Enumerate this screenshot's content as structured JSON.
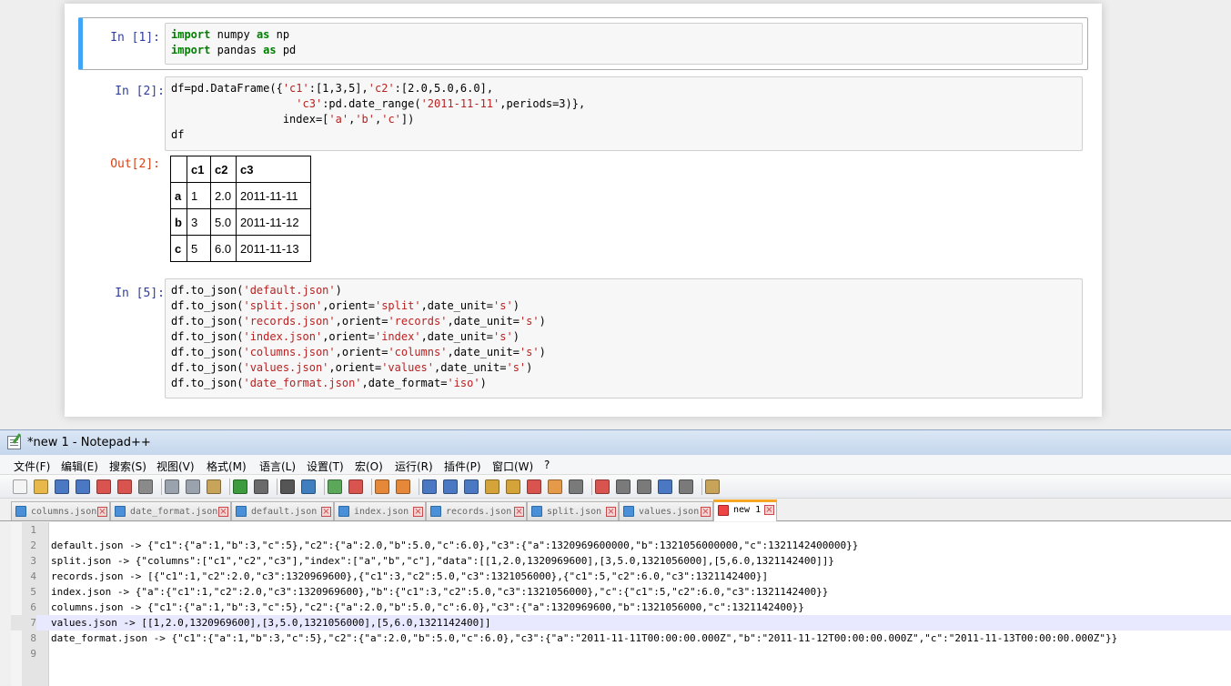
{
  "notebook": {
    "cells": [
      {
        "prompt": "In  [1]:",
        "lines": [
          [
            {
              "t": "import",
              "c": "kw"
            },
            {
              "t": " numpy "
            },
            {
              "t": "as",
              "c": "kw"
            },
            {
              "t": " np"
            }
          ],
          [
            {
              "t": "import",
              "c": "kw"
            },
            {
              "t": " pandas "
            },
            {
              "t": "as",
              "c": "kw"
            },
            {
              "t": " pd"
            }
          ]
        ]
      },
      {
        "prompt": "In  [2]:",
        "lines": [
          [
            {
              "t": "df=pd.DataFrame({"
            },
            {
              "t": "'c1'",
              "c": "st"
            },
            {
              "t": ":[1,3,5],"
            },
            {
              "t": "'c2'",
              "c": "st"
            },
            {
              "t": ":[2.0,5.0,6.0],"
            }
          ],
          [
            {
              "t": "                   "
            },
            {
              "t": "'c3'",
              "c": "st"
            },
            {
              "t": ":pd.date_range("
            },
            {
              "t": "'2011-11-11'",
              "c": "st"
            },
            {
              "t": ",periods=3)},"
            }
          ],
          [
            {
              "t": "                 index=["
            },
            {
              "t": "'a'",
              "c": "st"
            },
            {
              "t": ","
            },
            {
              "t": "'b'",
              "c": "st"
            },
            {
              "t": ","
            },
            {
              "t": "'c'",
              "c": "st"
            },
            {
              "t": "])"
            }
          ],
          [
            {
              "t": "df"
            }
          ]
        ]
      },
      {
        "prompt": "In  [5]:",
        "lines": [
          [
            {
              "t": "df.to_json("
            },
            {
              "t": "'default.json'",
              "c": "st"
            },
            {
              "t": ")"
            }
          ],
          [
            {
              "t": "df.to_json("
            },
            {
              "t": "'split.json'",
              "c": "st"
            },
            {
              "t": ",orient="
            },
            {
              "t": "'split'",
              "c": "st"
            },
            {
              "t": ",date_unit="
            },
            {
              "t": "'s'",
              "c": "st"
            },
            {
              "t": ")"
            }
          ],
          [
            {
              "t": "df.to_json("
            },
            {
              "t": "'records.json'",
              "c": "st"
            },
            {
              "t": ",orient="
            },
            {
              "t": "'records'",
              "c": "st"
            },
            {
              "t": ",date_unit="
            },
            {
              "t": "'s'",
              "c": "st"
            },
            {
              "t": ")"
            }
          ],
          [
            {
              "t": "df.to_json("
            },
            {
              "t": "'index.json'",
              "c": "st"
            },
            {
              "t": ",orient="
            },
            {
              "t": "'index'",
              "c": "st"
            },
            {
              "t": ",date_unit="
            },
            {
              "t": "'s'",
              "c": "st"
            },
            {
              "t": ")"
            }
          ],
          [
            {
              "t": "df.to_json("
            },
            {
              "t": "'columns.json'",
              "c": "st"
            },
            {
              "t": ",orient="
            },
            {
              "t": "'columns'",
              "c": "st"
            },
            {
              "t": ",date_unit="
            },
            {
              "t": "'s'",
              "c": "st"
            },
            {
              "t": ")"
            }
          ],
          [
            {
              "t": "df.to_json("
            },
            {
              "t": "'values.json'",
              "c": "st"
            },
            {
              "t": ",orient="
            },
            {
              "t": "'values'",
              "c": "st"
            },
            {
              "t": ",date_unit="
            },
            {
              "t": "'s'",
              "c": "st"
            },
            {
              "t": ")"
            }
          ],
          [
            {
              "t": "df.to_json("
            },
            {
              "t": "'date_format.json'",
              "c": "st"
            },
            {
              "t": ",date_format="
            },
            {
              "t": "'iso'",
              "c": "st"
            },
            {
              "t": ")"
            }
          ]
        ]
      }
    ],
    "output": {
      "prompt": "Out[2]:",
      "columns": [
        "",
        "c1",
        "c2",
        "c3"
      ],
      "rows": [
        [
          "a",
          "1",
          "2.0",
          "2011-11-11"
        ],
        [
          "b",
          "3",
          "5.0",
          "2011-11-12"
        ],
        [
          "c",
          "5",
          "6.0",
          "2011-11-13"
        ]
      ]
    }
  },
  "npp": {
    "title": "*new 1 - Notepad++",
    "menu": [
      "文件(F)",
      "编辑(E)",
      "搜索(S)",
      "视图(V)",
      "格式(M)",
      "语言(L)",
      "设置(T)",
      "宏(O)",
      "运行(R)",
      "插件(P)",
      "窗口(W)",
      "?"
    ],
    "toolbar_icons": [
      {
        "name": "new-file-icon",
        "color": "#f4f4f4"
      },
      {
        "name": "open-file-icon",
        "color": "#e8b84a"
      },
      {
        "name": "save-icon",
        "color": "#4a78c2"
      },
      {
        "name": "save-all-icon",
        "color": "#4a78c2"
      },
      {
        "name": "close-icon",
        "color": "#d9534f"
      },
      {
        "name": "close-all-icon",
        "color": "#d9534f"
      },
      {
        "name": "print-icon",
        "color": "#8a8a8a"
      },
      {
        "name": "sep"
      },
      {
        "name": "cut-icon",
        "color": "#9aa3ad"
      },
      {
        "name": "copy-icon",
        "color": "#9aa3ad"
      },
      {
        "name": "paste-icon",
        "color": "#c8a45a"
      },
      {
        "name": "sep"
      },
      {
        "name": "undo-icon",
        "color": "#3c9b3c"
      },
      {
        "name": "redo-icon",
        "color": "#6a6a6a"
      },
      {
        "name": "sep"
      },
      {
        "name": "find-icon",
        "color": "#555555"
      },
      {
        "name": "replace-icon",
        "color": "#3f7fbf"
      },
      {
        "name": "sep"
      },
      {
        "name": "zoom-in-icon",
        "color": "#5ba85b"
      },
      {
        "name": "zoom-out-icon",
        "color": "#d9534f"
      },
      {
        "name": "sep"
      },
      {
        "name": "sync-vertical-icon",
        "color": "#e6883a"
      },
      {
        "name": "sync-horizontal-icon",
        "color": "#e6883a"
      },
      {
        "name": "sep"
      },
      {
        "name": "word-wrap-icon",
        "color": "#4a78c2"
      },
      {
        "name": "show-all-chars-icon",
        "color": "#4a78c2"
      },
      {
        "name": "indent-guide-icon",
        "color": "#4a78c2"
      },
      {
        "name": "udl-icon",
        "color": "#d4a43a"
      },
      {
        "name": "doc-map-icon",
        "color": "#d4a43a"
      },
      {
        "name": "function-list-icon",
        "color": "#d9534f"
      },
      {
        "name": "folder-workspace-icon",
        "color": "#e59a4a"
      },
      {
        "name": "monitoring-icon",
        "color": "#7a7a7a"
      },
      {
        "name": "sep"
      },
      {
        "name": "record-macro-icon",
        "color": "#d9534f"
      },
      {
        "name": "stop-record-icon",
        "color": "#7a7a7a"
      },
      {
        "name": "play-macro-icon",
        "color": "#7a7a7a"
      },
      {
        "name": "run-macro-multiple-icon",
        "color": "#4a78c2"
      },
      {
        "name": "save-macro-icon",
        "color": "#7a7a7a"
      },
      {
        "name": "sep"
      },
      {
        "name": "spell-check-icon",
        "color": "#c8a45a"
      }
    ],
    "tabs": [
      {
        "label": "columns.json",
        "active": false
      },
      {
        "label": "date_format.json",
        "active": false
      },
      {
        "label": "default.json",
        "active": false
      },
      {
        "label": "index.json",
        "active": false
      },
      {
        "label": "records.json",
        "active": false
      },
      {
        "label": "split.json",
        "active": false
      },
      {
        "label": "values.json",
        "active": false
      },
      {
        "label": "new 1",
        "active": true
      }
    ],
    "lines": [
      "",
      "default.json -> {\"c1\":{\"a\":1,\"b\":3,\"c\":5},\"c2\":{\"a\":2.0,\"b\":5.0,\"c\":6.0},\"c3\":{\"a\":1320969600000,\"b\":1321056000000,\"c\":1321142400000}}",
      "split.json -> {\"columns\":[\"c1\",\"c2\",\"c3\"],\"index\":[\"a\",\"b\",\"c\"],\"data\":[[1,2.0,1320969600],[3,5.0,1321056000],[5,6.0,1321142400]]}",
      "records.json -> [{\"c1\":1,\"c2\":2.0,\"c3\":1320969600},{\"c1\":3,\"c2\":5.0,\"c3\":1321056000},{\"c1\":5,\"c2\":6.0,\"c3\":1321142400}]",
      "index.json -> {\"a\":{\"c1\":1,\"c2\":2.0,\"c3\":1320969600},\"b\":{\"c1\":3,\"c2\":5.0,\"c3\":1321056000},\"c\":{\"c1\":5,\"c2\":6.0,\"c3\":1321142400}}",
      "columns.json -> {\"c1\":{\"a\":1,\"b\":3,\"c\":5},\"c2\":{\"a\":2.0,\"b\":5.0,\"c\":6.0},\"c3\":{\"a\":1320969600,\"b\":1321056000,\"c\":1321142400}}",
      "values.json -> [[1,2.0,1320969600],[3,5.0,1321056000],[5,6.0,1321142400]]",
      "date_format.json -> {\"c1\":{\"a\":1,\"b\":3,\"c\":5},\"c2\":{\"a\":2.0,\"b\":5.0,\"c\":6.0},\"c3\":{\"a\":\"2011-11-11T00:00:00.000Z\",\"b\":\"2011-11-12T00:00:00.000Z\",\"c\":\"2011-11-13T00:00:00.000Z\"}}",
      ""
    ],
    "current_line": 7
  }
}
